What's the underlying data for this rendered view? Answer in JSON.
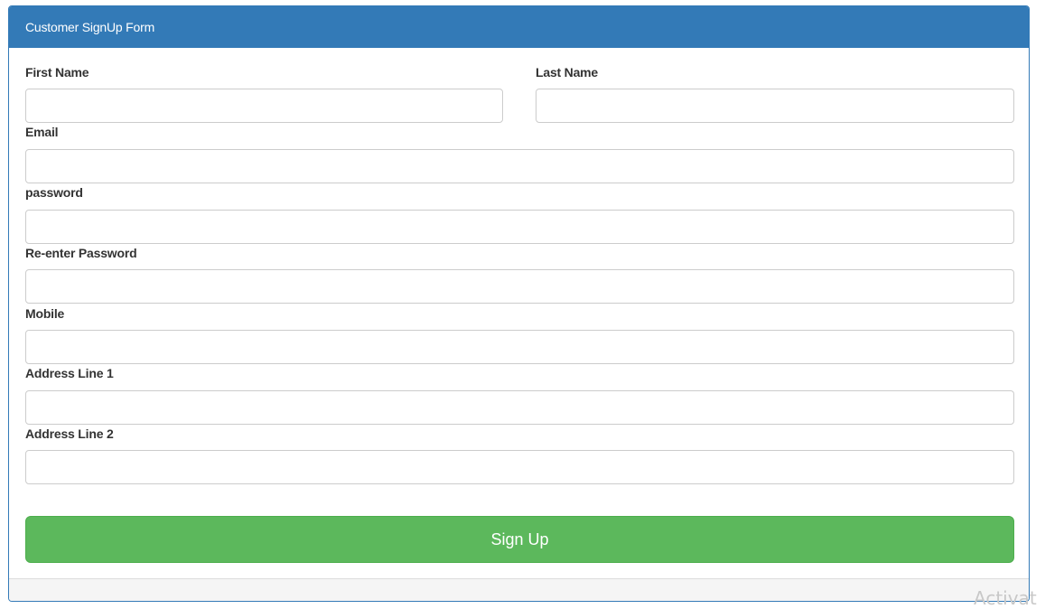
{
  "panel": {
    "title": "Customer SignUp Form"
  },
  "form": {
    "first_name": {
      "label": "First Name",
      "value": "",
      "placeholder": ""
    },
    "last_name": {
      "label": "Last Name",
      "value": "",
      "placeholder": ""
    },
    "email": {
      "label": "Email",
      "value": "",
      "placeholder": ""
    },
    "password": {
      "label": "password",
      "value": "",
      "placeholder": ""
    },
    "reenter_password": {
      "label": "Re-enter Password",
      "value": "",
      "placeholder": ""
    },
    "mobile": {
      "label": "Mobile",
      "value": "",
      "placeholder": ""
    },
    "address1": {
      "label": "Address Line 1",
      "value": "",
      "placeholder": ""
    },
    "address2": {
      "label": "Address Line 2",
      "value": "",
      "placeholder": ""
    },
    "submit_label": "Sign Up"
  },
  "overlay": {
    "watermark_text": "Activat"
  },
  "colors": {
    "header": "#337ab7",
    "button": "#5cb85c"
  }
}
